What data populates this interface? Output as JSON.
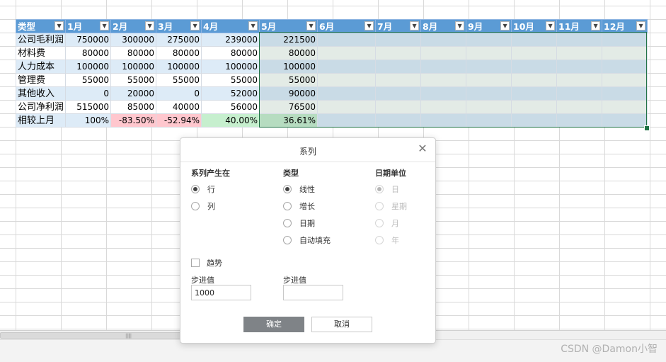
{
  "sheet": {
    "headers": [
      "类型",
      "1月",
      "2月",
      "3月",
      "4月",
      "5月",
      "6月",
      "7月",
      "8月",
      "9月",
      "10月",
      "11月",
      "12月"
    ],
    "rows": [
      {
        "label": "公司毛利润",
        "values": [
          "750000",
          "300000",
          "275000",
          "239000",
          "221500"
        ]
      },
      {
        "label": "材料费",
        "values": [
          "80000",
          "80000",
          "80000",
          "80000",
          "80000"
        ]
      },
      {
        "label": "人力成本",
        "values": [
          "100000",
          "100000",
          "100000",
          "100000",
          "100000"
        ]
      },
      {
        "label": "管理费",
        "values": [
          "55000",
          "55000",
          "55000",
          "55000",
          "55000"
        ]
      },
      {
        "label": "其他收入",
        "values": [
          "0",
          "20000",
          "0",
          "52000",
          "90000"
        ]
      },
      {
        "label": "公司净利润",
        "values": [
          "515000",
          "85000",
          "40000",
          "56000",
          "76500"
        ]
      },
      {
        "label": "相较上月",
        "values": [
          "100%",
          "-83.50%",
          "-52.94%",
          "40.00%",
          "36.61%"
        ]
      }
    ],
    "colors": {
      "header": "#5b9bd5",
      "band": "#ddebf7",
      "negative": "#ffc7ce",
      "positive": "#c6efce",
      "selection_border": "#217346"
    }
  },
  "dialog": {
    "title": "系列",
    "close_icon": "close-icon",
    "series_in": {
      "title": "系列产生在",
      "options": [
        "行",
        "列"
      ],
      "selected": "行"
    },
    "type": {
      "title": "类型",
      "options": [
        "线性",
        "增长",
        "日期",
        "自动填充"
      ],
      "selected": "线性"
    },
    "date_unit": {
      "title": "日期单位",
      "options": [
        "日",
        "星期",
        "月",
        "年"
      ],
      "selected": "日",
      "disabled": true
    },
    "trend_label": "趋势",
    "trend_checked": false,
    "step_label": "步进值",
    "step_value": "1000",
    "stop_label": "步进值",
    "stop_value": "",
    "ok_label": "确定",
    "cancel_label": "取消"
  },
  "watermark": "CSDN @Damon小智"
}
